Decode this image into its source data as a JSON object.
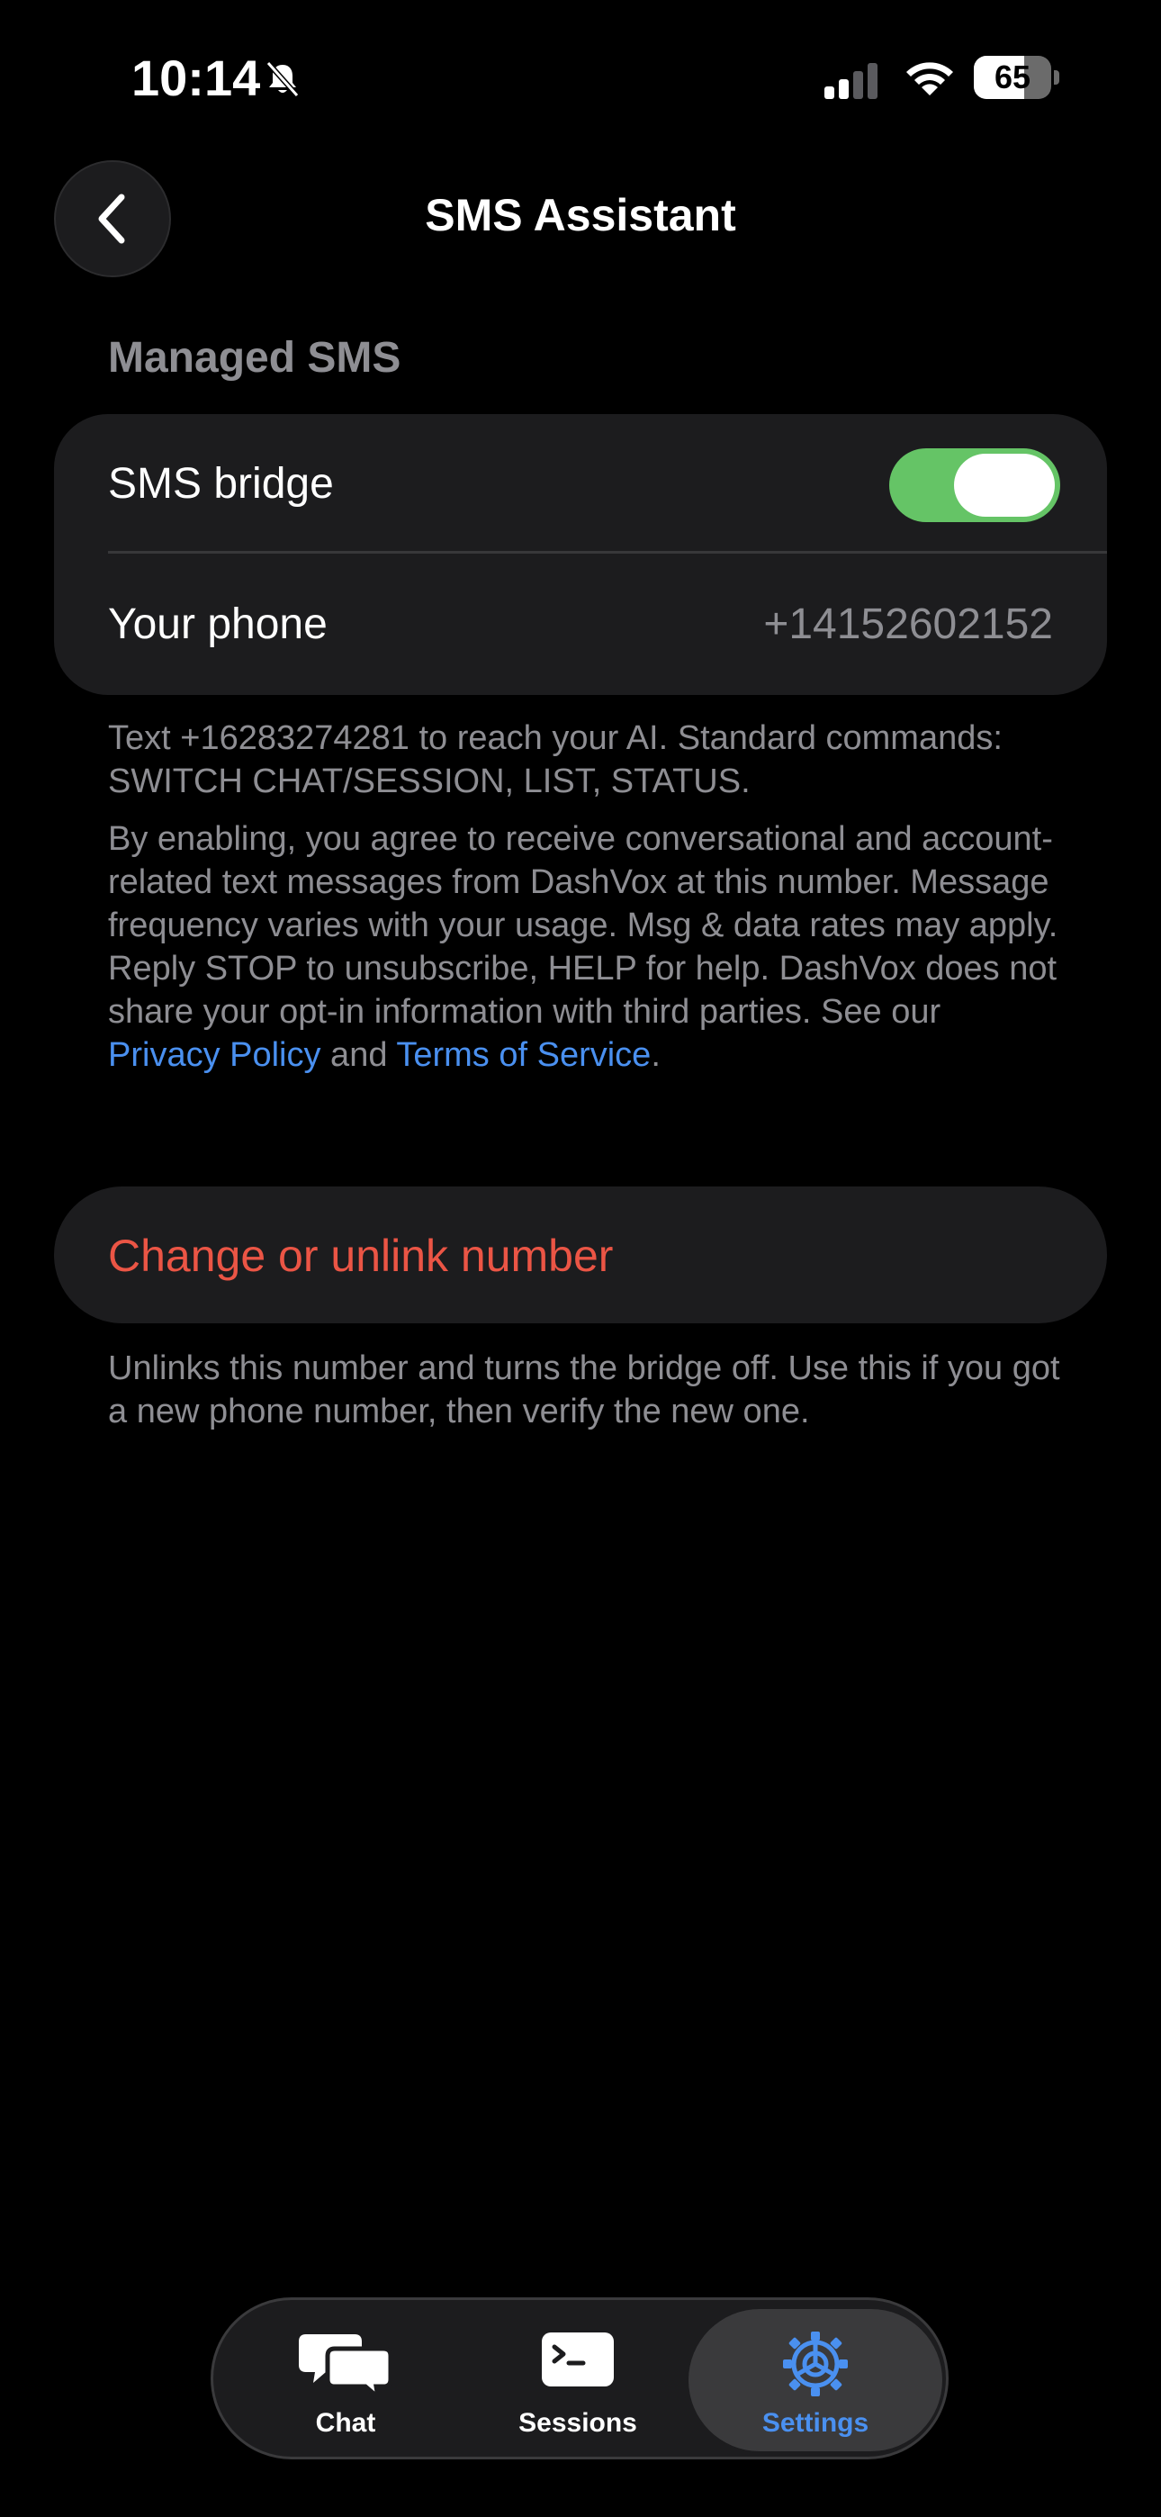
{
  "status_bar": {
    "time": "10:14",
    "battery_percent": 65,
    "battery_label": "65",
    "icons": [
      "bell-slash-icon",
      "cellular-signal-icon",
      "wifi-icon",
      "battery-icon"
    ]
  },
  "nav": {
    "back_icon": "chevron-left-icon",
    "title": "SMS Assistant"
  },
  "section": {
    "header": "Managed SMS"
  },
  "settings": {
    "sms_bridge_label": "SMS bridge",
    "sms_bridge_enabled": true,
    "your_phone_label": "Your phone",
    "your_phone_value": "+14152602152"
  },
  "footnotes": {
    "commands": "Text +16283274281 to reach your AI. Standard commands: SWITCH CHAT/SESSION, LIST, STATUS.",
    "consent_text": "By enabling, you agree to receive conversational and account-related text messages from DashVox at this number. Message frequency varies with your usage. Msg & data rates may apply. Reply STOP to unsubscribe, HELP for help. DashVox does not share your opt-in information with third parties. See our ",
    "privacy_link": "Privacy Policy",
    "and_text": " and ",
    "terms_link": "Terms of Service",
    "period": "."
  },
  "unlink": {
    "button_label": "Change or unlink number",
    "footnote": "Unlinks this number and turns the bridge off. Use this if you got a new phone number, then verify the new one."
  },
  "tab_bar": {
    "tabs": [
      {
        "label": "Chat",
        "icon": "chat-bubbles-icon",
        "selected": false
      },
      {
        "label": "Sessions",
        "icon": "terminal-icon",
        "selected": false
      },
      {
        "label": "Settings",
        "icon": "gear-icon",
        "selected": true
      }
    ]
  },
  "colors": {
    "background": "#000000",
    "card": "#1c1c1e",
    "toggle_on": "#65c466",
    "secondary_text": "#8e8e93",
    "link": "#4a90f0",
    "destructive": "#eb5545"
  }
}
